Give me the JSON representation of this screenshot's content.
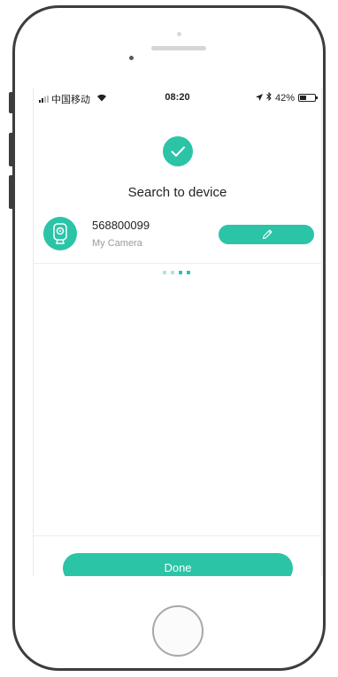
{
  "status_bar": {
    "carrier": "中国移动",
    "time": "08:20",
    "battery_text": "42%",
    "battery_level": 0.42,
    "wifi_icon": "wifi-icon",
    "location_icon": "location-arrow-icon",
    "bluetooth_icon": "bluetooth-icon"
  },
  "header": {
    "success_icon": "checkmark-icon",
    "title": "Search to device"
  },
  "device": {
    "id": "568800099",
    "name": "My Camera",
    "icon": "camera-icon",
    "edit_icon": "pencil-icon"
  },
  "loading_indicator": {
    "dots": 4,
    "active_from": 2
  },
  "footer": {
    "done_label": "Done"
  },
  "colors": {
    "accent": "#2bc4a7",
    "accent_light": "#a8e8da",
    "text": "#222222",
    "muted": "#9a9a9a"
  }
}
